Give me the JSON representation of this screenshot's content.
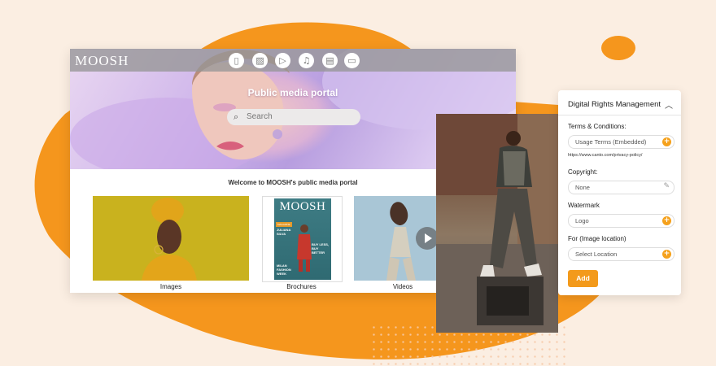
{
  "app": {
    "logo": "MOOSH"
  },
  "nav_icons": [
    "document-icon",
    "image-icon",
    "play-icon",
    "music-icon",
    "file-icon",
    "presentation-icon"
  ],
  "hero": {
    "title": "Public media portal",
    "search_placeholder": "Search"
  },
  "welcome": "Welcome to MOOSH's public media portal",
  "categories": [
    {
      "label": "Images"
    },
    {
      "label": "Brochures"
    },
    {
      "label": "Videos"
    }
  ],
  "magazine": {
    "title": "MOOSH",
    "tag": "MAGAZINE",
    "name": "JULIANA SILVA",
    "tagline": "BUY LESS, BUY BETTER",
    "event": "MILAN FASHION WEEK"
  },
  "drm": {
    "title": "Digital Rights Management",
    "terms": {
      "label": "Terms & Conditions:",
      "value": "Usage Terms (Embedded)",
      "url": "https://www.canto.com/privacy-policy/"
    },
    "copyright": {
      "label": "Copyright:",
      "value": "None"
    },
    "watermark": {
      "label": "Watermark",
      "value": "Logo"
    },
    "location": {
      "label": "For (Image location)",
      "value": "Select Location"
    },
    "add_label": "Add"
  },
  "colors": {
    "accent": "#f39a1b",
    "blob": "#f5961d",
    "background": "#fbeee2"
  }
}
